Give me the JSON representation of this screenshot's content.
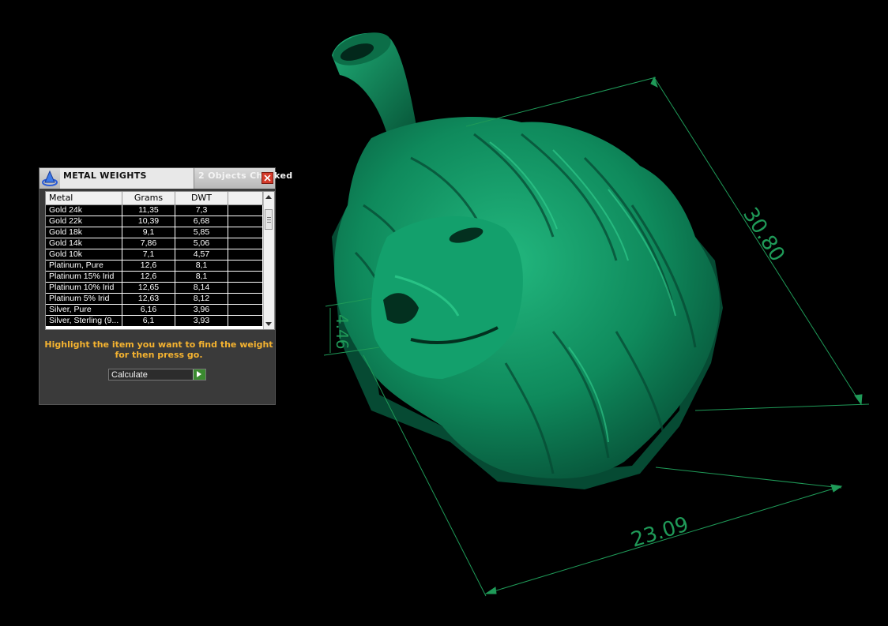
{
  "viewport": {
    "dimension_width": "23.09",
    "dimension_length": "30.80",
    "dimension_thickness": "4.46",
    "model_color": "#0f8a5c",
    "dimension_color": "#1f9a58"
  },
  "dialog": {
    "title": "METAL WEIGHTS",
    "info": "2 Objects Checked",
    "columns": [
      "Metal",
      "Grams",
      "DWT"
    ],
    "rows": [
      {
        "metal": "Gold 24k",
        "grams": "11,35",
        "dwt": "7,3"
      },
      {
        "metal": "Gold 22k",
        "grams": "10,39",
        "dwt": "6,68"
      },
      {
        "metal": "Gold 18k",
        "grams": "9,1",
        "dwt": "5,85"
      },
      {
        "metal": "Gold 14k",
        "grams": "7,86",
        "dwt": "5,06"
      },
      {
        "metal": "Gold 10k",
        "grams": "7,1",
        "dwt": "4,57"
      },
      {
        "metal": "Platinum, Pure",
        "grams": "12,6",
        "dwt": "8,1"
      },
      {
        "metal": "Platinum 15% Irid",
        "grams": "12,6",
        "dwt": "8,1"
      },
      {
        "metal": "Platinum 10% Irid",
        "grams": "12,65",
        "dwt": "8,14"
      },
      {
        "metal": "Platinum 5% Irid",
        "grams": "12,63",
        "dwt": "8,12"
      },
      {
        "metal": "Silver, Pure",
        "grams": "6,16",
        "dwt": "3,96"
      },
      {
        "metal": "Silver, Sterling (9...",
        "grams": "6,1",
        "dwt": "3,93"
      }
    ],
    "hint": "Highlight the item you want to find the weight for then press go.",
    "calculate_label": "Calculate",
    "accent_color": "#f5b330",
    "close_color": "#d43a2a",
    "go_color": "#3a8a2f"
  }
}
